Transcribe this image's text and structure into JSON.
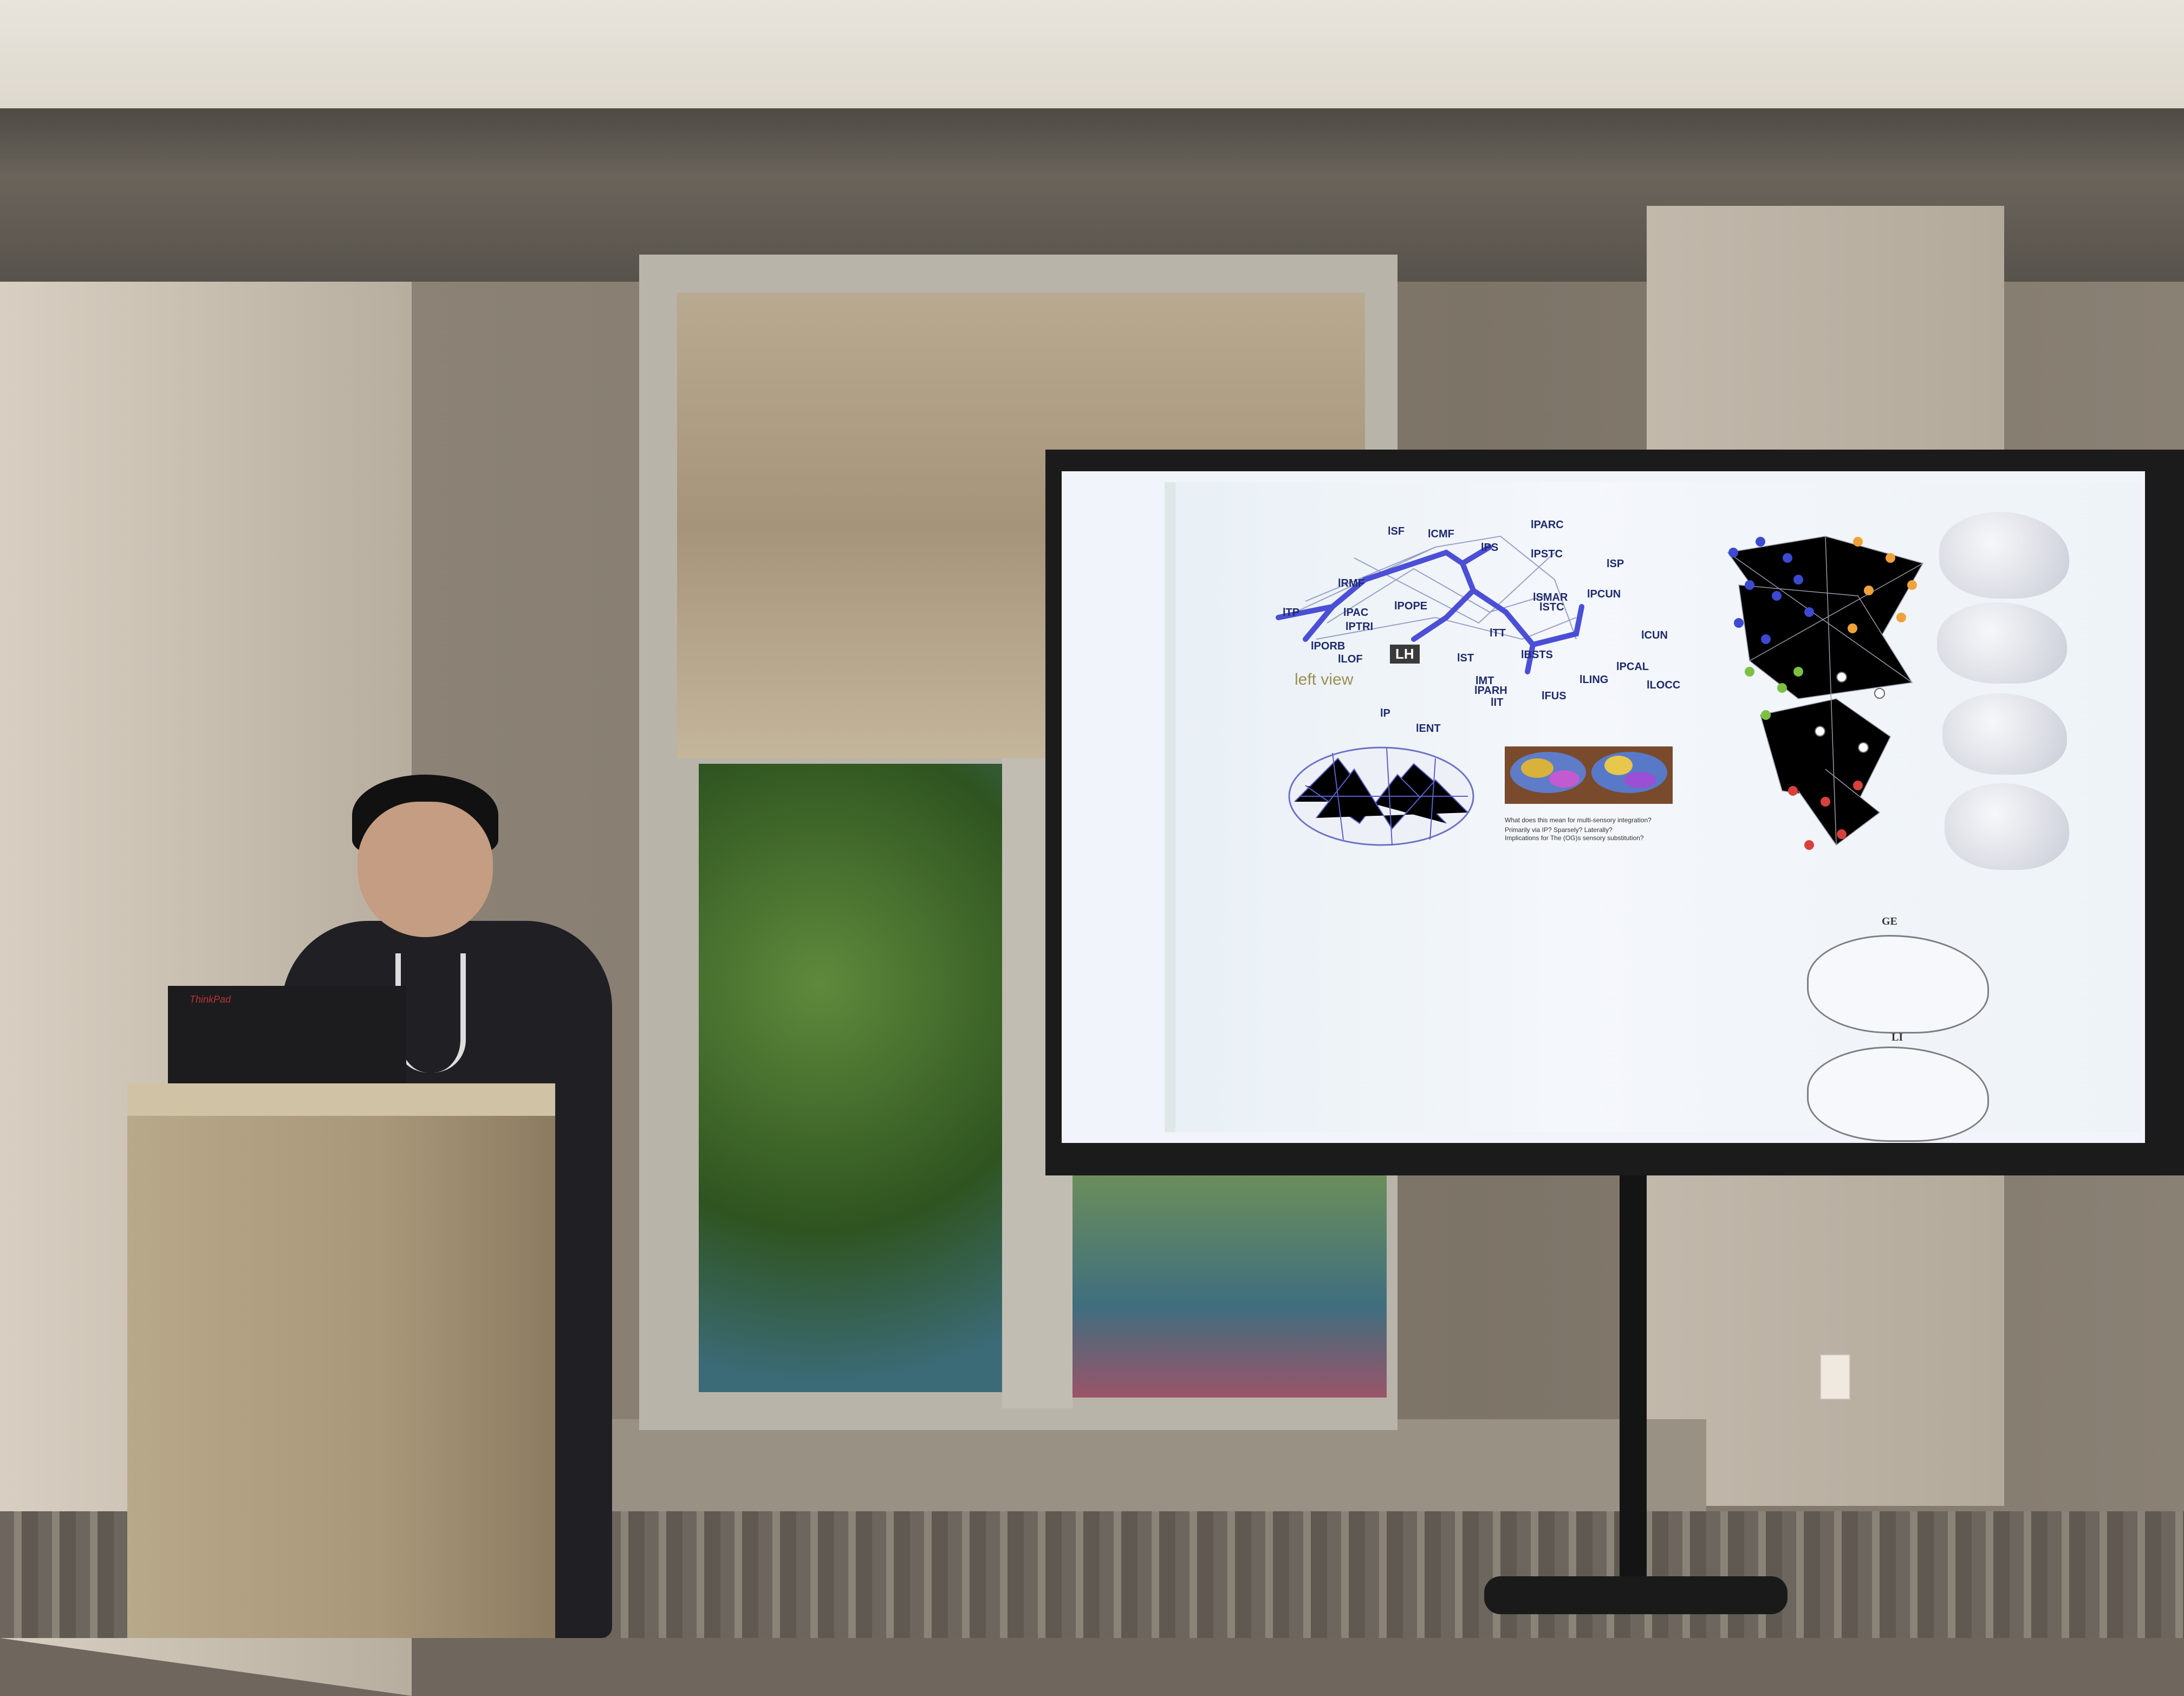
{
  "slide": {
    "network_labels": [
      "lSF",
      "lCMF",
      "lPARC",
      "lPS",
      "lPSTC",
      "lSP",
      "lRMF",
      "lPCUN",
      "lSMAR",
      "lSTC",
      "lPAC",
      "lPOPE",
      "lPTRI",
      "lPORB",
      "lLOF",
      "lTT",
      "lCUN",
      "lST",
      "lBSTS",
      "lMT",
      "lPARH",
      "lIT",
      "lFUS",
      "lLING",
      "lPCAL",
      "lLOCC",
      "lTP",
      "lENT",
      "lP"
    ],
    "left_view": "left view",
    "hemisphere_badge": "LH",
    "question_text": "What does this mean for multi-sensory integration? Primarily via IP? Sparsely? Laterally?",
    "implications_text": "Implications for The (OG)s sensory substitution?",
    "diagram_top_label": "GE",
    "diagram_bottom_label": "LI"
  },
  "laptop": {
    "brand": "ThinkPad"
  },
  "colors": {
    "network_edge": "#4b4fd6",
    "node_blue": "#3c4ad1",
    "node_orange": "#f0a23a",
    "node_green": "#7dc043",
    "node_red": "#d8413b"
  }
}
